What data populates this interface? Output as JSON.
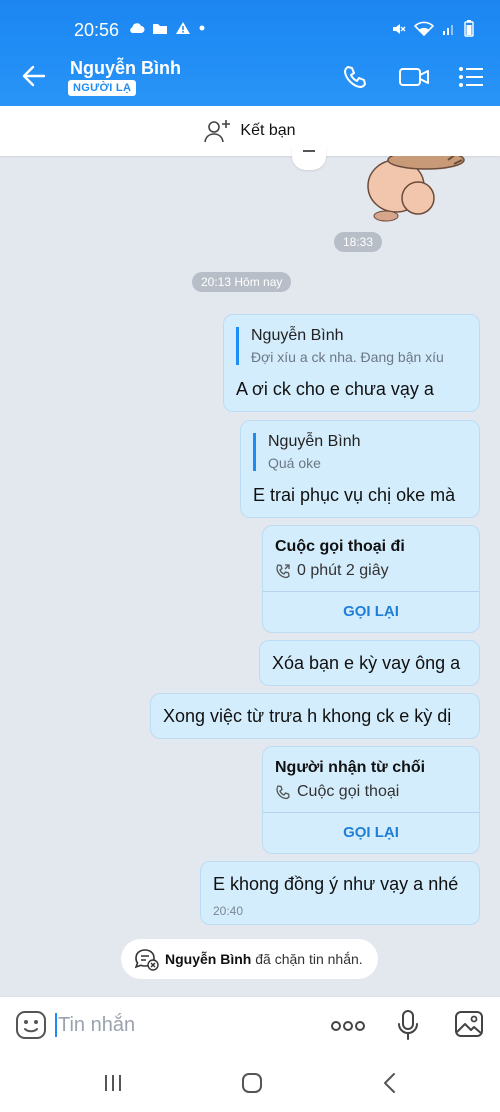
{
  "status_bar": {
    "time": "20:56"
  },
  "header": {
    "contact_name": "Nguyễn Bình",
    "badge": "NGƯỜI LẠ"
  },
  "add_friend": {
    "label": "Kết bạn"
  },
  "chat": {
    "time_1833": "18:33",
    "date_separator": "20:13 Hôm nay",
    "messages": [
      {
        "quote_name": "Nguyễn Bình",
        "quote_text": "Đợi xíu a ck nha. Đang bận xíu",
        "text": "A ơi ck cho e chưa vạy a"
      },
      {
        "quote_name": "Nguyễn Bình",
        "quote_text": "Quá oke",
        "text": "E trai phục vụ chị oke mà"
      }
    ],
    "call_1": {
      "title": "Cuộc gọi thoại đi",
      "detail": "0 phút 2 giây",
      "action": "GỌI LẠI"
    },
    "msg_3": "Xóa bạn e kỳ vay ông a",
    "msg_4": "Xong việc từ trưa h khong ck e kỳ dị",
    "call_2": {
      "title": "Người nhận từ chối",
      "detail": "Cuộc gọi thoại",
      "action": "GỌI LẠI"
    },
    "msg_5": {
      "text": "E khong đồng ý như vạy a nhé",
      "time": "20:40"
    },
    "system_notice": {
      "name": "Nguyễn Bình",
      "text": "đã chặn tin nhắn."
    }
  },
  "input": {
    "placeholder": "Tin nhắn"
  },
  "colors": {
    "accent": "#1f8cf5",
    "bubble": "#d4edfc",
    "chat_bg": "#e3e7ee"
  }
}
